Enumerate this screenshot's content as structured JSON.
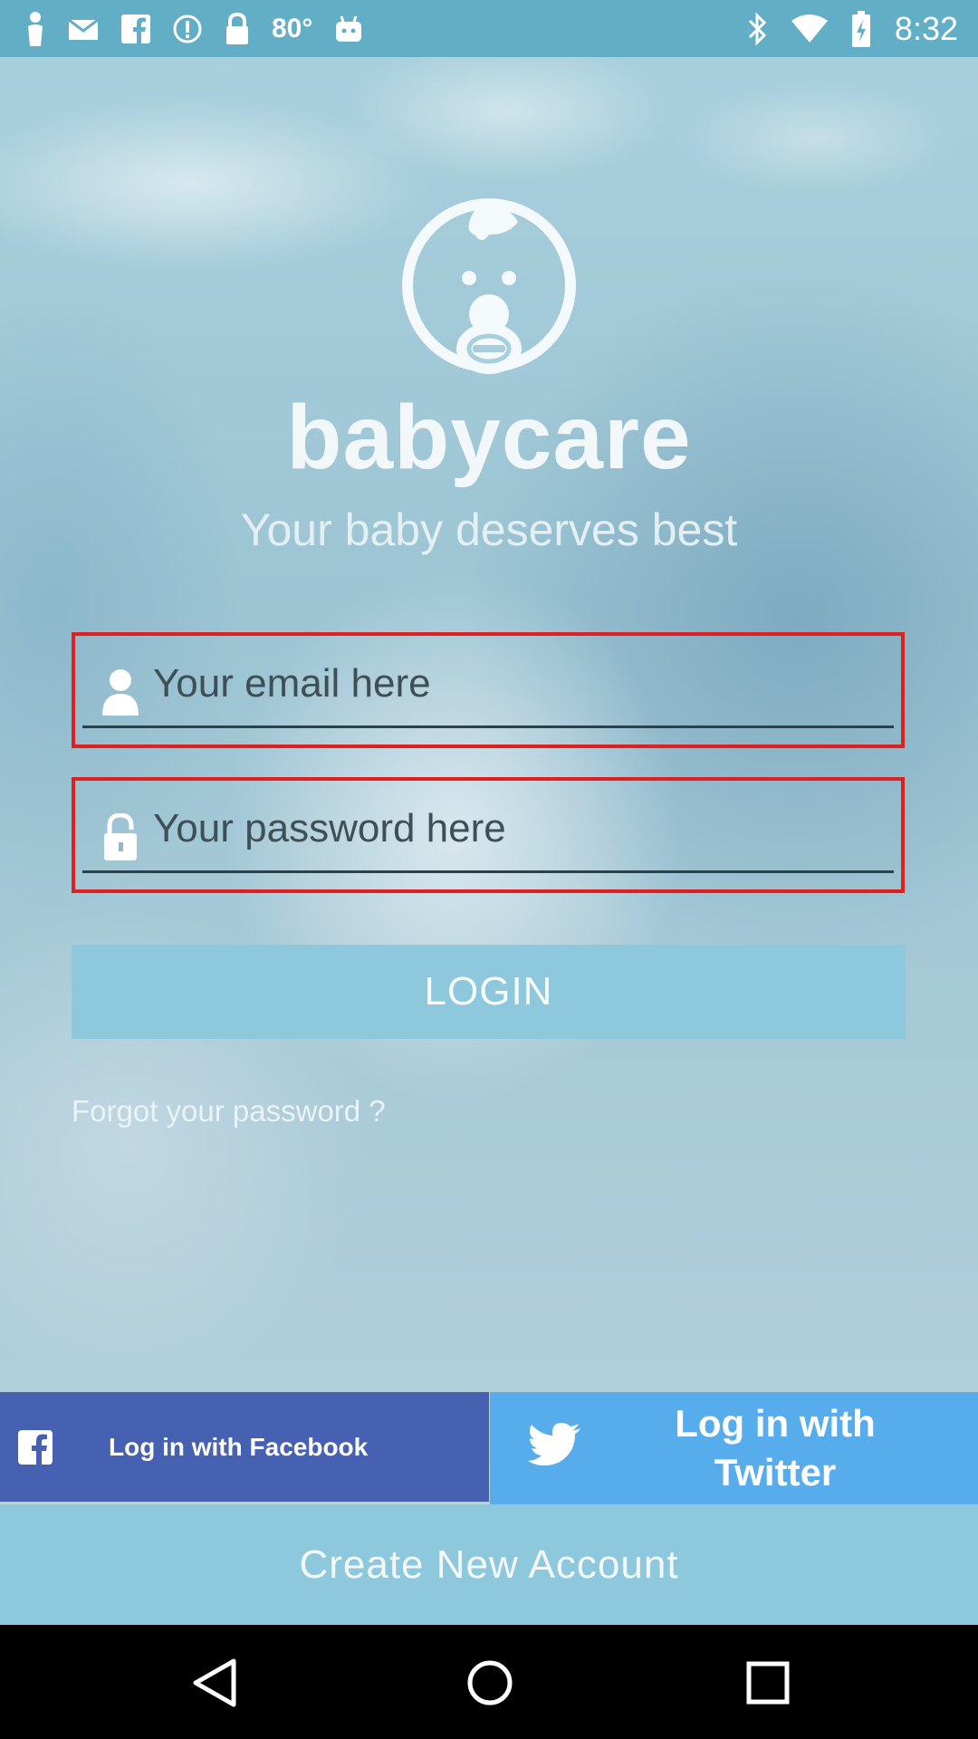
{
  "status_bar": {
    "temperature": "80°",
    "time": "8:32"
  },
  "app": {
    "brand": "babycare",
    "tagline": "Your baby deserves best"
  },
  "login_form": {
    "email_placeholder": "Your email here",
    "password_placeholder": "Your password here",
    "login_label": "LOGIN",
    "forgot_label": "Forgot your password ?"
  },
  "social": {
    "facebook_label": "Log in with Facebook",
    "twitter_label": "Log in with Twitter"
  },
  "footer": {
    "create_account_label": "Create New Account"
  },
  "colors": {
    "status_bar": "#63aec7",
    "primary_button": "#8ec8dc",
    "facebook": "#4661b1",
    "twitter": "#57adec",
    "highlight_border": "#e02020"
  },
  "icons": {
    "status_left": [
      "person-icon",
      "mail-icon",
      "facebook-icon",
      "alert-icon",
      "lock-icon",
      "android-icon"
    ],
    "status_right": [
      "bluetooth-icon",
      "wifi-icon",
      "battery-icon"
    ],
    "nav": [
      "back-icon",
      "home-icon",
      "recents-icon"
    ]
  }
}
